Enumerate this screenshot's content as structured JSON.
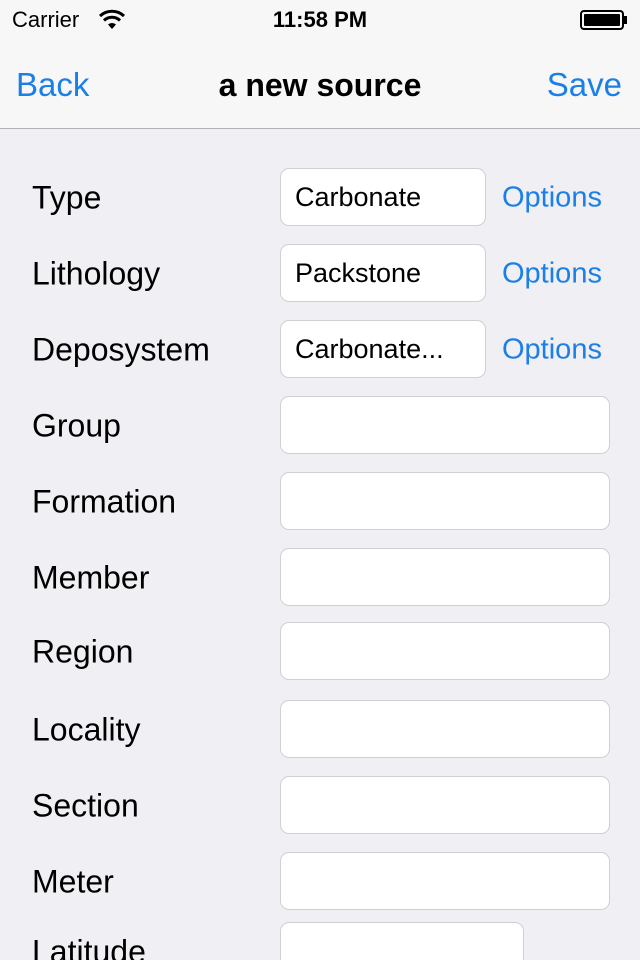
{
  "status_bar": {
    "carrier": "Carrier",
    "time": "11:58 PM"
  },
  "nav": {
    "back": "Back",
    "title": "a new source",
    "save": "Save"
  },
  "form": {
    "options_label": "Options",
    "rows": [
      {
        "label": "Type",
        "value": "Carbonate"
      },
      {
        "label": "Lithology",
        "value": "Packstone"
      },
      {
        "label": "Deposystem",
        "value": "Carbonate..."
      },
      {
        "label": "Group",
        "value": ""
      },
      {
        "label": "Formation",
        "value": ""
      },
      {
        "label": "Member",
        "value": ""
      },
      {
        "label": "Region",
        "value": ""
      },
      {
        "label": "Locality",
        "value": ""
      },
      {
        "label": "Section",
        "value": ""
      },
      {
        "label": "Meter",
        "value": ""
      },
      {
        "label": "Latitude",
        "value": ""
      }
    ]
  },
  "colors": {
    "accent": "#1a7fe8",
    "background": "#efeff4",
    "bar": "#f7f7f7"
  }
}
